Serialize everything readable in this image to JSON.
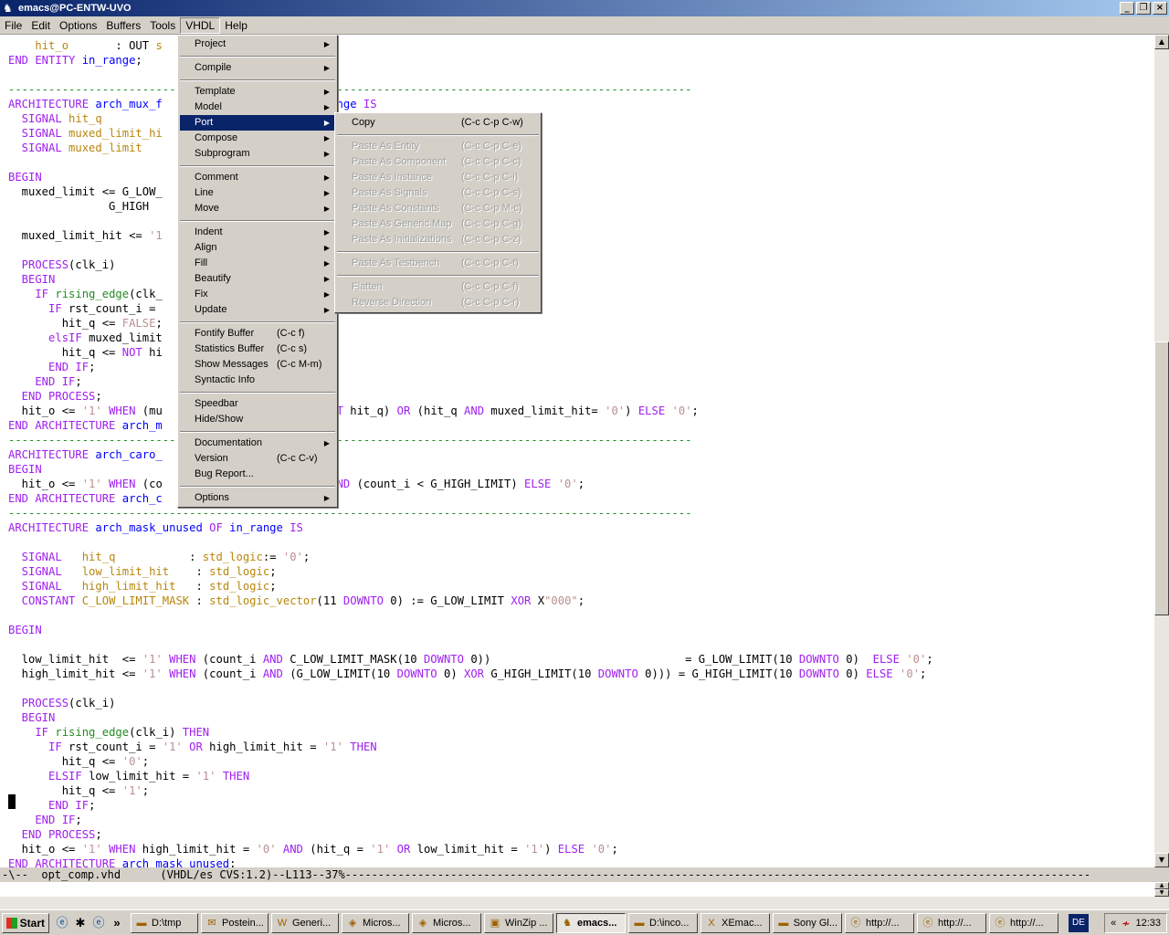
{
  "window": {
    "title": "emacs@PC-ENTW-UVO",
    "app_icon": "emacs-gnu-icon",
    "buttons": [
      "_",
      "❐",
      "×"
    ]
  },
  "menubar": [
    "File",
    "Edit",
    "Options",
    "Buffers",
    "Tools",
    "VHDL",
    "Help"
  ],
  "vhdl_menu": {
    "items": [
      {
        "label": "Project",
        "submenu": true
      },
      {
        "label": "Compile",
        "submenu": true
      },
      {
        "label": "Template",
        "submenu": true
      },
      {
        "label": "Model",
        "submenu": true
      },
      {
        "label": "Port",
        "submenu": true,
        "highlighted": true
      },
      {
        "label": "Compose",
        "submenu": true
      },
      {
        "label": "Subprogram",
        "submenu": true
      },
      {
        "label": "Comment",
        "submenu": true
      },
      {
        "label": "Line",
        "submenu": true
      },
      {
        "label": "Move",
        "submenu": true
      },
      {
        "label": "Indent",
        "submenu": true
      },
      {
        "label": "Align",
        "submenu": true
      },
      {
        "label": "Fill",
        "submenu": true
      },
      {
        "label": "Beautify",
        "submenu": true
      },
      {
        "label": "Fix",
        "submenu": true
      },
      {
        "label": "Update",
        "submenu": true
      },
      {
        "label": "Fontify Buffer",
        "key": "(C-c f)"
      },
      {
        "label": "Statistics Buffer",
        "key": "(C-c s)"
      },
      {
        "label": "Show Messages",
        "key": "(C-c M-m)"
      },
      {
        "label": "Syntactic Info"
      },
      {
        "label": "Speedbar"
      },
      {
        "label": "Hide/Show"
      },
      {
        "label": "Documentation",
        "submenu": true
      },
      {
        "label": "Version",
        "key": "(C-c C-v)"
      },
      {
        "label": "Bug Report..."
      },
      {
        "label": "Options",
        "submenu": true
      }
    ]
  },
  "port_menu": {
    "items": [
      {
        "label": "Copy",
        "key": "(C-c C-p C-w)",
        "disabled": false
      },
      {
        "label": "Paste As Entity",
        "key": "(C-c C-p C-e)",
        "disabled": true
      },
      {
        "label": "Paste As Component",
        "key": "(C-c C-p C-c)",
        "disabled": true
      },
      {
        "label": "Paste As Instance",
        "key": "(C-c C-p C-i)",
        "disabled": true
      },
      {
        "label": "Paste As Signals",
        "key": "(C-c C-p C-s)",
        "disabled": true
      },
      {
        "label": "Paste As Constants",
        "key": "(C-c C-p M-c)",
        "disabled": true
      },
      {
        "label": "Paste As Generic Map",
        "key": "(C-c C-p C-g)",
        "disabled": true
      },
      {
        "label": "Paste As Initializations",
        "key": "(C-c C-p C-z)",
        "disabled": true
      },
      {
        "label": "Paste As Testbench",
        "key": "(C-c C-p C-t)",
        "disabled": true
      },
      {
        "label": "Flatten",
        "key": "(C-c C-p C-f)",
        "disabled": true
      },
      {
        "label": "Reverse Direction",
        "key": "(C-c C-p C-r)",
        "disabled": true
      }
    ]
  },
  "code_lines": [
    [
      [
        "    ",
        ""
      ],
      [
        "hit_o",
        "vn"
      ],
      [
        "       : ",
        ""
      ],
      [
        "OUT",
        ""
      ],
      [
        " s",
        "vn"
      ]
    ],
    [
      [
        "END ENTITY ",
        "kw"
      ],
      [
        "in_range",
        "fn"
      ],
      [
        ";",
        ""
      ]
    ],
    [
      [
        "",
        ""
      ]
    ],
    [
      [
        "------------------------------------------------------------------------------------------------------",
        "sep"
      ]
    ],
    [
      [
        "ARCHITECTURE ",
        "kw"
      ],
      [
        "arch_mux_f",
        "fn"
      ],
      [
        "                        ",
        ""
      ],
      [
        "range",
        "fn"
      ],
      [
        " IS",
        "kw"
      ]
    ],
    [
      [
        "  SIGNAL ",
        "kw"
      ],
      [
        "hit_q",
        "vn"
      ]
    ],
    [
      [
        "  SIGNAL ",
        "kw"
      ],
      [
        "muxed_limit_hi",
        "vn"
      ]
    ],
    [
      [
        "  SIGNAL ",
        "kw"
      ],
      [
        "muxed_limit",
        "vn"
      ]
    ],
    [
      [
        "",
        ""
      ]
    ],
    [
      [
        "BEGIN",
        "kw"
      ]
    ],
    [
      [
        "  muxed_limit <= G_LOW_",
        ""
      ]
    ],
    [
      [
        "               G_HIGH",
        ""
      ]
    ],
    [
      [
        "",
        ""
      ]
    ],
    [
      [
        "  muxed_limit_hit <= ",
        ""
      ],
      [
        "'1",
        "st"
      ]
    ],
    [
      [
        "",
        ""
      ]
    ],
    [
      [
        "  PROCESS",
        "kw"
      ],
      [
        "(clk_i)",
        ""
      ]
    ],
    [
      [
        "  BEGIN",
        "kw"
      ]
    ],
    [
      [
        "    IF ",
        "kw"
      ],
      [
        "rising_edge",
        "ty"
      ],
      [
        "(clk_",
        ""
      ]
    ],
    [
      [
        "      IF ",
        "kw"
      ],
      [
        "rst_count_i = ",
        ""
      ]
    ],
    [
      [
        "        hit_q <= ",
        ""
      ],
      [
        "FALSE",
        "st"
      ],
      [
        ";",
        ""
      ]
    ],
    [
      [
        "      elsIF ",
        "kw"
      ],
      [
        "muxed_limit",
        ""
      ]
    ],
    [
      [
        "        hit_q <= ",
        ""
      ],
      [
        "NOT ",
        "kw"
      ],
      [
        "hi",
        ""
      ]
    ],
    [
      [
        "      END IF",
        "kw"
      ],
      [
        ";",
        ""
      ]
    ],
    [
      [
        "    END IF",
        "kw"
      ],
      [
        ";",
        ""
      ]
    ],
    [
      [
        "  END PROCESS",
        "kw"
      ],
      [
        ";",
        ""
      ]
    ],
    [
      [
        "  hit_o <= ",
        ""
      ],
      [
        "'1' ",
        "st"
      ],
      [
        "WHEN ",
        "kw"
      ],
      [
        "(mu",
        ""
      ],
      [
        "                      ",
        ""
      ],
      [
        "D NOT ",
        "kw"
      ],
      [
        "hit_q) ",
        ""
      ],
      [
        "OR ",
        "kw"
      ],
      [
        "(hit_q ",
        ""
      ],
      [
        "AND ",
        "kw"
      ],
      [
        "muxed_limit_hit= ",
        ""
      ],
      [
        "'0'",
        "st"
      ],
      [
        ") ",
        ""
      ],
      [
        "ELSE ",
        "kw"
      ],
      [
        "'0'",
        "st"
      ],
      [
        ";",
        ""
      ]
    ],
    [
      [
        "END ARCHITECTURE ",
        "kw"
      ],
      [
        "arch_m",
        "fn"
      ]
    ],
    [
      [
        "------------------------------------------------------------------------------------------------------",
        "sep"
      ]
    ],
    [
      [
        "ARCHITECTURE ",
        "kw"
      ],
      [
        "arch_caro_",
        "fn"
      ]
    ],
    [
      [
        "BEGIN",
        "kw"
      ]
    ],
    [
      [
        "  hit_o <= ",
        ""
      ],
      [
        "'1' ",
        "st"
      ],
      [
        "WHEN ",
        "kw"
      ],
      [
        "(co",
        ""
      ],
      [
        "                      ",
        ""
      ],
      [
        "1) ",
        ""
      ],
      [
        "AND ",
        "kw"
      ],
      [
        "(count_i < G_HIGH_LIMIT) ",
        ""
      ],
      [
        "ELSE ",
        "kw"
      ],
      [
        "'0'",
        "st"
      ],
      [
        ";",
        ""
      ]
    ],
    [
      [
        "END ARCHITECTURE ",
        "kw"
      ],
      [
        "arch_c",
        "fn"
      ]
    ],
    [
      [
        "------------------------------------------------------------------------------------------------------",
        "sep"
      ]
    ],
    [
      [
        "ARCHITECTURE ",
        "kw"
      ],
      [
        "arch_mask_unused ",
        "fn"
      ],
      [
        "OF ",
        "kw"
      ],
      [
        "in_range ",
        "fn"
      ],
      [
        "IS",
        "kw"
      ]
    ],
    [
      [
        "",
        ""
      ]
    ],
    [
      [
        "  SIGNAL   ",
        "kw"
      ],
      [
        "hit_q",
        "vn"
      ],
      [
        "           : ",
        ""
      ],
      [
        "std_logic",
        "vn"
      ],
      [
        ":= ",
        ""
      ],
      [
        "'0'",
        "st"
      ],
      [
        ";",
        ""
      ]
    ],
    [
      [
        "  SIGNAL   ",
        "kw"
      ],
      [
        "low_limit_hit",
        "vn"
      ],
      [
        "    : ",
        ""
      ],
      [
        "std_logic",
        "vn"
      ],
      [
        ";",
        ""
      ]
    ],
    [
      [
        "  SIGNAL   ",
        "kw"
      ],
      [
        "high_limit_hit",
        "vn"
      ],
      [
        "   : ",
        ""
      ],
      [
        "std_logic",
        "vn"
      ],
      [
        ";",
        ""
      ]
    ],
    [
      [
        "  CONSTANT ",
        "kw"
      ],
      [
        "C_LOW_LIMIT_MASK",
        "vn"
      ],
      [
        " : ",
        ""
      ],
      [
        "std_logic_vector",
        "vn"
      ],
      [
        "(11 ",
        ""
      ],
      [
        "DOWNTO ",
        "kw"
      ],
      [
        "0) := G_LOW_LIMIT ",
        ""
      ],
      [
        "XOR ",
        "kw"
      ],
      [
        "X",
        ""
      ],
      [
        "\"000\"",
        "st"
      ],
      [
        ";",
        ""
      ]
    ],
    [
      [
        "",
        ""
      ]
    ],
    [
      [
        "BEGIN",
        "kw"
      ]
    ],
    [
      [
        "",
        ""
      ]
    ],
    [
      [
        "  low_limit_hit  <= ",
        ""
      ],
      [
        "'1' ",
        "st"
      ],
      [
        "WHEN ",
        "kw"
      ],
      [
        "(count_i ",
        ""
      ],
      [
        "AND ",
        "kw"
      ],
      [
        "C_LOW_LIMIT_MASK(10 ",
        ""
      ],
      [
        "DOWNTO ",
        "kw"
      ],
      [
        "0))                             = G_LOW_LIMIT(10 ",
        ""
      ],
      [
        "DOWNTO ",
        "kw"
      ],
      [
        "0)  ",
        ""
      ],
      [
        "ELSE ",
        "kw"
      ],
      [
        "'0'",
        "st"
      ],
      [
        ";",
        ""
      ]
    ],
    [
      [
        "  high_limit_hit <= ",
        ""
      ],
      [
        "'1' ",
        "st"
      ],
      [
        "WHEN ",
        "kw"
      ],
      [
        "(count_i ",
        ""
      ],
      [
        "AND ",
        "kw"
      ],
      [
        "(G_LOW_LIMIT(10 ",
        ""
      ],
      [
        "DOWNTO ",
        "kw"
      ],
      [
        "0) ",
        ""
      ],
      [
        "XOR ",
        "kw"
      ],
      [
        "G_HIGH_LIMIT(10 ",
        ""
      ],
      [
        "DOWNTO ",
        "kw"
      ],
      [
        "0))) = G_HIGH_LIMIT(10 ",
        ""
      ],
      [
        "DOWNTO ",
        "kw"
      ],
      [
        "0) ",
        ""
      ],
      [
        "ELSE ",
        "kw"
      ],
      [
        "'0'",
        "st"
      ],
      [
        ";",
        ""
      ]
    ],
    [
      [
        "",
        ""
      ]
    ],
    [
      [
        "  PROCESS",
        "kw"
      ],
      [
        "(clk_i)",
        ""
      ]
    ],
    [
      [
        "  BEGIN",
        "kw"
      ]
    ],
    [
      [
        "    IF ",
        "kw"
      ],
      [
        "rising_edge",
        "ty"
      ],
      [
        "(clk_i) ",
        ""
      ],
      [
        "THEN",
        "kw"
      ]
    ],
    [
      [
        "      IF ",
        "kw"
      ],
      [
        "rst_count_i = ",
        ""
      ],
      [
        "'1' ",
        "st"
      ],
      [
        "OR ",
        "kw"
      ],
      [
        "high_limit_hit = ",
        ""
      ],
      [
        "'1' ",
        "st"
      ],
      [
        "THEN",
        "kw"
      ]
    ],
    [
      [
        "        hit_q <= ",
        ""
      ],
      [
        "'0'",
        "st"
      ],
      [
        ";",
        ""
      ]
    ],
    [
      [
        "      ELSIF ",
        "kw"
      ],
      [
        "low_limit_hit = ",
        ""
      ],
      [
        "'1' ",
        "st"
      ],
      [
        "THEN",
        "kw"
      ]
    ],
    [
      [
        "        hit_q <= ",
        ""
      ],
      [
        "'1'",
        "st"
      ],
      [
        ";",
        ""
      ]
    ],
    [
      [
        "      END IF",
        "kw"
      ],
      [
        ";",
        ""
      ]
    ],
    [
      [
        "    END IF",
        "kw"
      ],
      [
        ";",
        ""
      ]
    ],
    [
      [
        "  END PROCESS",
        "kw"
      ],
      [
        ";",
        ""
      ]
    ],
    [
      [
        "  hit_o <= ",
        ""
      ],
      [
        "'1' ",
        "st"
      ],
      [
        "WHEN ",
        "kw"
      ],
      [
        "high_limit_hit = ",
        ""
      ],
      [
        "'0' ",
        "st"
      ],
      [
        "AND ",
        "kw"
      ],
      [
        "(hit_q = ",
        ""
      ],
      [
        "'1' ",
        "st"
      ],
      [
        "OR ",
        "kw"
      ],
      [
        "low_limit_hit = ",
        ""
      ],
      [
        "'1'",
        "st"
      ],
      [
        ") ",
        ""
      ],
      [
        "ELSE ",
        "kw"
      ],
      [
        "'0'",
        "st"
      ],
      [
        ";",
        ""
      ]
    ],
    [
      [
        "END ARCHITECTURE ",
        "kw"
      ],
      [
        "arch_mask_unused",
        "fn"
      ],
      [
        ";",
        ""
      ]
    ]
  ],
  "modeline": "-\\--  opt_comp.vhd      (VHDL/es CVS:1.2)--L113--37%-----------------------------------------------------------------------------------------------------------------",
  "taskbar": {
    "start": "Start",
    "quicklaunch": [
      "ie-icon",
      "bug-icon",
      "ie-icon",
      "more-chevron"
    ],
    "quicklaunch_chevron": "»",
    "buttons": [
      {
        "label": "D:\\tmp",
        "icon": "folder-icon"
      },
      {
        "label": "Postein...",
        "icon": "mail-icon"
      },
      {
        "label": "Generi...",
        "icon": "word-icon"
      },
      {
        "label": "Micros...",
        "icon": "app-icon"
      },
      {
        "label": "Micros...",
        "icon": "app-icon"
      },
      {
        "label": "WinZip ...",
        "icon": "winzip-icon"
      },
      {
        "label": "emacs...",
        "icon": "emacs-icon",
        "pressed": true
      },
      {
        "label": "D:\\inco...",
        "icon": "folder-icon"
      },
      {
        "label": "XEmac...",
        "icon": "xemacs-icon"
      },
      {
        "label": "Sony Gl...",
        "icon": "folder-icon"
      },
      {
        "label": "http://...",
        "icon": "ie-icon"
      },
      {
        "label": "http://...",
        "icon": "ie-icon"
      },
      {
        "label": "http://...",
        "icon": "ie-icon"
      }
    ],
    "lang": "DE",
    "tray_chevron": "«",
    "clock": "12:33"
  },
  "colors": {
    "menu_highlight": "#0a246a",
    "keyword": "#a020f0",
    "type": "#228b22",
    "variable": "#b8860b",
    "string": "#bc8f8f",
    "function": "#0000ff"
  }
}
